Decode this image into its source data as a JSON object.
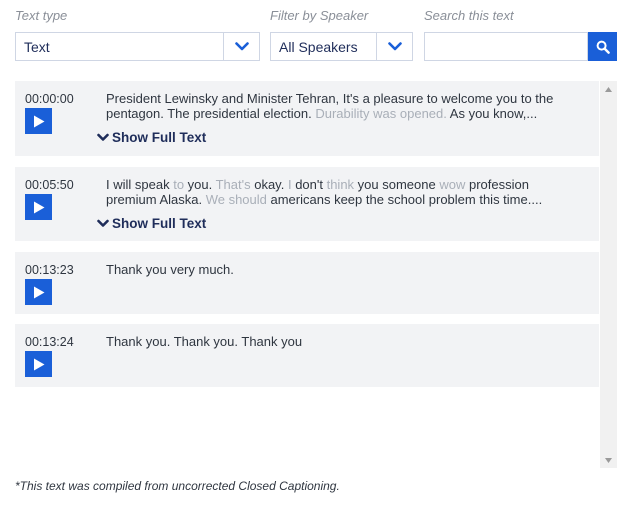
{
  "filters": {
    "text_type_label": "Text type",
    "text_type_value": "Text",
    "speaker_label": "Filter by Speaker",
    "speaker_value": "All Speakers",
    "search_label": "Search this text",
    "search_value": "",
    "search_placeholder": ""
  },
  "entries": [
    {
      "time": "00:00:00",
      "line1": [
        {
          "t": "President Lewinsky and Minister Tehran, It's a pleasure to welcome you to the",
          "faint": false
        }
      ],
      "line2": [
        {
          "t": "pentagon. The presidential election. ",
          "faint": false
        },
        {
          "t": "Durability was opened.",
          "faint": true
        },
        {
          "t": " As you know,...",
          "faint": false
        }
      ],
      "show_full": "Show Full Text"
    },
    {
      "time": "00:05:50",
      "line1": [
        {
          "t": "I will speak ",
          "faint": false
        },
        {
          "t": "to",
          "faint": true
        },
        {
          "t": " you. ",
          "faint": false
        },
        {
          "t": "That's",
          "faint": true
        },
        {
          "t": " okay. ",
          "faint": false
        },
        {
          "t": "I",
          "faint": true
        },
        {
          "t": " don't ",
          "faint": false
        },
        {
          "t": "think",
          "faint": true
        },
        {
          "t": " you someone ",
          "faint": false
        },
        {
          "t": "wow",
          "faint": true
        },
        {
          "t": " profession",
          "faint": false
        }
      ],
      "line2": [
        {
          "t": "premium Alaska. ",
          "faint": false
        },
        {
          "t": "We should",
          "faint": true
        },
        {
          "t": " americans keep the school problem this time....",
          "faint": false
        }
      ],
      "show_full": "Show Full Text"
    },
    {
      "time": "00:13:23",
      "line1": [
        {
          "t": "Thank you very much.",
          "faint": false
        }
      ],
      "line2": [],
      "show_full": ""
    },
    {
      "time": "00:13:24",
      "line1": [
        {
          "t": "Thank you. Thank you. Thank you",
          "faint": false
        }
      ],
      "line2": [],
      "show_full": ""
    }
  ],
  "footnote": "*This text was compiled from uncorrected Closed Captioning.",
  "colors": {
    "accent": "#1a5fd8",
    "entry_bg": "#f2f3f5",
    "faint_text": "#a9afb8",
    "dark_text": "#1f2d5a"
  },
  "icons": {
    "chevron": "chevron-down-icon",
    "search": "search-icon",
    "play": "play-icon",
    "scroll_up": "arrow-up-icon",
    "scroll_down": "arrow-down-icon"
  }
}
